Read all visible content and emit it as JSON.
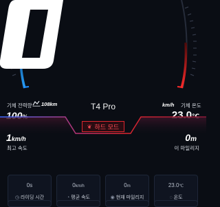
{
  "gauge": {
    "left_color": "#1f8fff",
    "right_color": "#ff2a2a"
  },
  "status": {
    "battery_label": "기체 전력량",
    "range_value": "108km",
    "battery_value": "100",
    "battery_unit": "%",
    "model": "T4 Pro",
    "temp_unit_label": "km/h",
    "temp_label": "기체 온도",
    "temp_value": "23.0",
    "temp_unit": "℃"
  },
  "mode": {
    "label": "하드 모드",
    "icon": "leaf-icon",
    "accent": "#e0262f"
  },
  "stats": {
    "top_speed_value": "1",
    "top_speed_unit": "km/h",
    "top_speed_label": "최고 속도",
    "mileage_value": "0",
    "mileage_unit": "m",
    "mileage_label": "이 마일리지"
  },
  "cards": [
    {
      "value": "0s",
      "unit": "",
      "label": "라이딩 시간",
      "icon": "clock-icon"
    },
    {
      "value": "0",
      "unit": "km/h",
      "label": "평균 속도",
      "icon": "speedometer-icon"
    },
    {
      "value": "0",
      "unit": "m",
      "label": "현재 마일리지",
      "icon": "road-icon"
    },
    {
      "value": "23.0",
      "unit": "℃",
      "label": "온도",
      "icon": "thermometer-icon"
    }
  ]
}
